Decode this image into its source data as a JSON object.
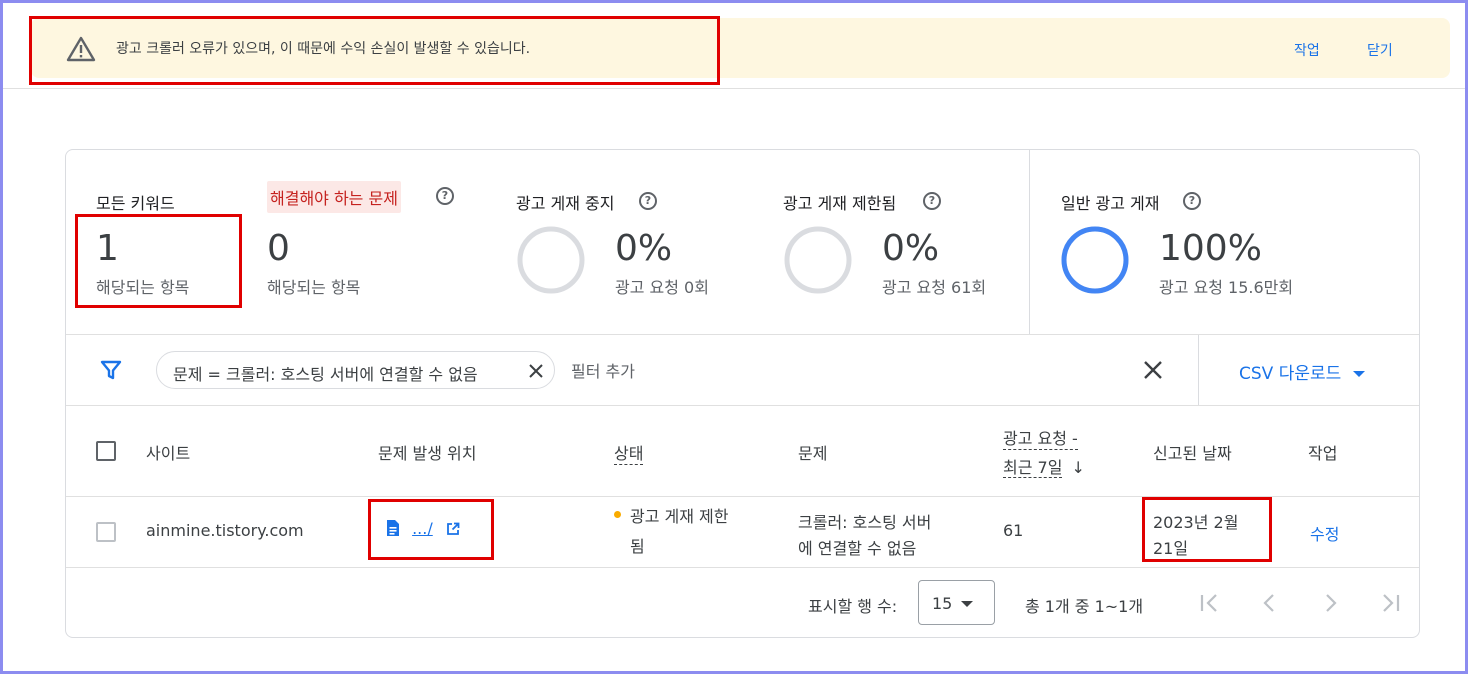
{
  "alert": {
    "message": "광고 크롤러 오류가 있으며, 이 때문에 수익 손실이 발생할 수 있습니다.",
    "action_label": "작업",
    "dismiss_label": "닫기"
  },
  "stats": {
    "all_keywords": {
      "label": "모든 키워드",
      "value": "1",
      "sub": "해당되는 항목"
    },
    "issues": {
      "label": "해결해야 하는 문제",
      "value": "0",
      "sub": "해당되는 항목"
    },
    "ad_serving_stopped": {
      "label": "광고 게재 중지",
      "percent": "0%",
      "sub": "광고 요청 0회",
      "fill": 0
    },
    "ad_serving_limited": {
      "label": "광고 게재 제한됨",
      "percent": "0%",
      "sub": "광고 요청 61회",
      "fill": 0
    },
    "normal_serving": {
      "label": "일반 광고 게재",
      "percent": "100%",
      "sub": "광고 요청 15.6만회",
      "fill": 1
    }
  },
  "colors": {
    "accent": "#1a73e8",
    "gauge_track": "#dadce0",
    "issue_bg": "#fce8e6",
    "issue_text": "#c5221f",
    "status_dot": "#f9ab00"
  },
  "filter": {
    "chip_label": "문제 = 크롤러: 호스팅 서버에 연결할 수 없음",
    "add_filter_placeholder": "필터 추가",
    "csv_download_label": "CSV 다운로드"
  },
  "table": {
    "headers": {
      "site": "사이트",
      "location": "문제 발생 위치",
      "status": "상태",
      "issue": "문제",
      "ad_requests_line1": "광고 요청 -",
      "ad_requests_line2": "최근 7일",
      "reported_date": "신고된 날짜",
      "action": "작업"
    },
    "rows": [
      {
        "site": "ainmine.tistory.com",
        "location": ".../",
        "status_line1": "광고 게재 제한",
        "status_line2": "됨",
        "issue_line1": "크롤러: 호스팅 서버",
        "issue_line2": "에 연결할 수 없음",
        "ad_requests": "61",
        "date_line1": "2023년 2월",
        "date_line2": "21일",
        "action": "수정"
      }
    ]
  },
  "pagination": {
    "rows_per_page_label": "표시할 행 수:",
    "rows_per_page_value": "15",
    "range_text": "총 1개 중 1~1개"
  }
}
